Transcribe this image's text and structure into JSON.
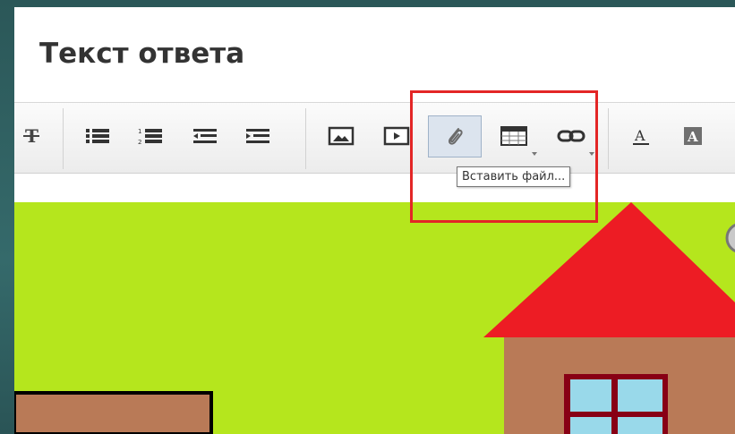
{
  "editor": {
    "title": "Текст ответа"
  },
  "toolbar": {
    "buttons": [
      {
        "name": "strikethrough",
        "icon": "strikethrough-icon"
      },
      {
        "name": "bulleted-list",
        "icon": "bulleted-list-icon"
      },
      {
        "name": "numbered-list",
        "icon": "numbered-list-icon"
      },
      {
        "name": "outdent",
        "icon": "outdent-icon"
      },
      {
        "name": "indent",
        "icon": "indent-icon"
      },
      {
        "name": "insert-image",
        "icon": "image-icon"
      },
      {
        "name": "insert-video",
        "icon": "video-icon"
      },
      {
        "name": "insert-file",
        "icon": "paperclip-icon",
        "active": true
      },
      {
        "name": "insert-table",
        "icon": "table-icon"
      },
      {
        "name": "insert-link",
        "icon": "link-icon"
      },
      {
        "name": "text-color",
        "icon": "text-color-icon"
      },
      {
        "name": "background-color",
        "icon": "background-color-icon"
      }
    ],
    "tooltip": "Вставить файл..."
  },
  "colors": {
    "highlight": "#e32626",
    "canvas_bg": "#b5e61d",
    "roof": "#ed1c24",
    "house_wall": "#b97a57",
    "window_glass": "#99d9ea",
    "window_frame": "#880015"
  }
}
